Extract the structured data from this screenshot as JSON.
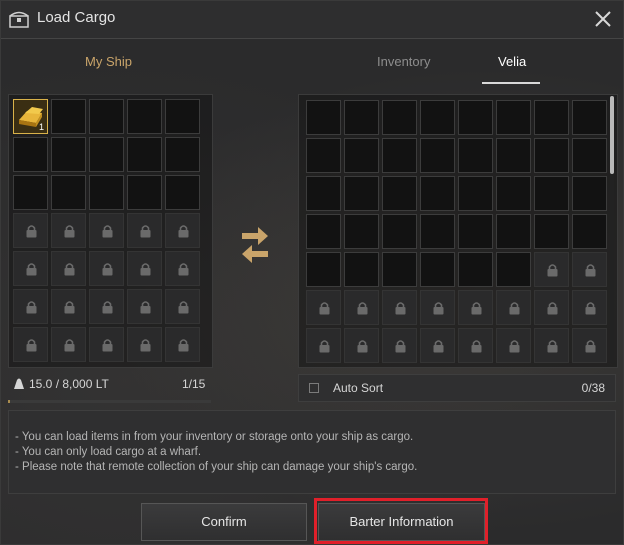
{
  "window": {
    "title": "Load Cargo",
    "accent_color": "#c9a46a",
    "highlight_color": "#e0202a"
  },
  "icons": {
    "title": "treasure-chest-icon",
    "close": "close-icon",
    "swap": "swap-arrows-icon",
    "lock": "lock-icon",
    "weight": "weight-icon",
    "item": "gold-ingot-icon"
  },
  "tabs": {
    "my_ship": "My Ship",
    "inventory": "Inventory",
    "velia": "Velia",
    "active": "Velia"
  },
  "ship_grid": {
    "rows": 7,
    "cols": 5,
    "unlocked_slots": 15,
    "item": {
      "name": "gold ingot",
      "count": "1",
      "slot": 0
    }
  },
  "storage_grid": {
    "rows": 7,
    "cols": 8,
    "unlocked_slots": 38
  },
  "ship_footer": {
    "weight": "15.0 / 8,000 LT",
    "slots": "1/15",
    "weight_fraction": 0.002
  },
  "auto_sort": {
    "label": "Auto Sort",
    "count": "0/38",
    "checked": false
  },
  "notices": [
    "- You can load items in from your inventory or storage onto your ship as cargo.",
    "- You can only load cargo at a wharf.",
    "- Please note that remote collection of your ship can damage your ship's cargo."
  ],
  "buttons": {
    "confirm": "Confirm",
    "barter": "Barter Information"
  }
}
